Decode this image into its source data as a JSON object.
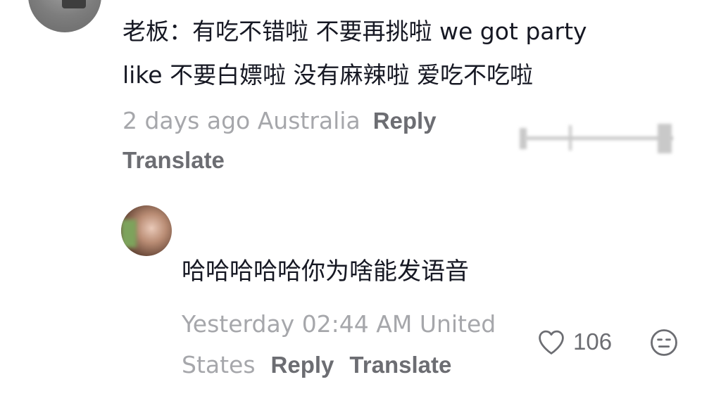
{
  "comment": {
    "line1": "老板：有吃不错啦 不要再挑啦 we got party",
    "line2": "like 不要白嫖啦 没有麻辣啦 爱吃不吃啦",
    "timestamp": "2 days ago Australia",
    "reply_label": "Reply",
    "translate_label": "Translate"
  },
  "reply": {
    "text": "哈哈哈哈哈你为啥能发语音",
    "timestamp_line1": "Yesterday 02:44 AM United",
    "timestamp_line2": "States",
    "reply_label": "Reply",
    "translate_label": "Translate",
    "like_count": "106"
  },
  "icons": {
    "like": "heart-outline-icon",
    "dislike": "meh-face-icon"
  },
  "colors": {
    "primary_text": "#161823",
    "secondary_text": "#a6a7ab",
    "action_text": "#6c6d72"
  }
}
